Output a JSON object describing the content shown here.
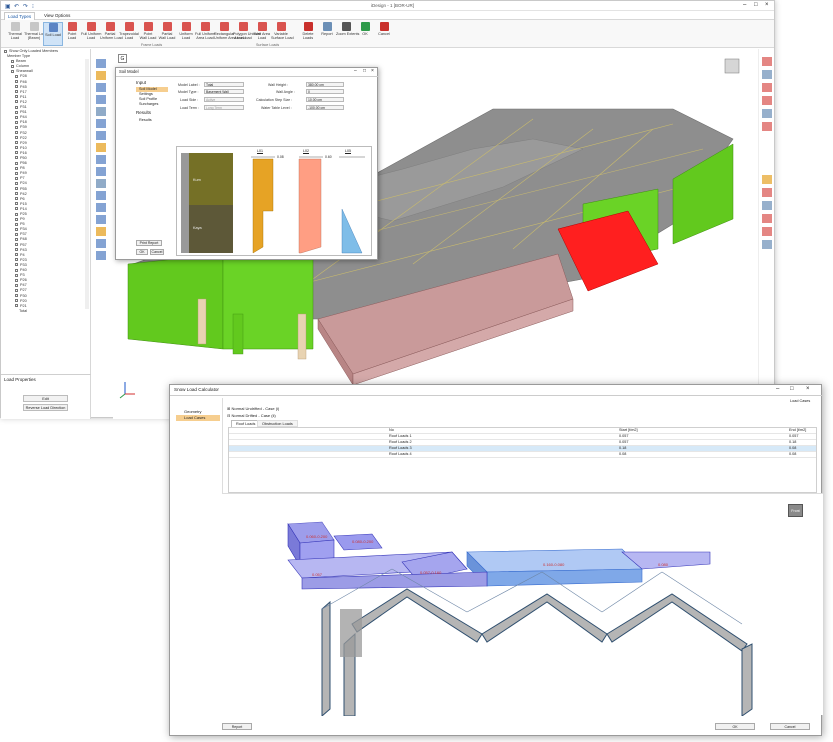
{
  "main": {
    "title": "iDesign - 1 [BOR-UR]",
    "tabs": [
      "Load Types",
      "View Options"
    ],
    "ribbon": [
      {
        "label": "Thermal\nLoad",
        "icon": "thermal-icon",
        "color": "#c7c7c7"
      },
      {
        "label": "Thermal Load\n(Beam)",
        "icon": "thermal-beam-icon",
        "color": "#c7c7c7"
      },
      {
        "label": "Soil Load",
        "icon": "soil-load-icon",
        "color": "#5b84c4",
        "active": true
      },
      {
        "label": "Point\nLoad",
        "icon": "point-load-icon",
        "color": "#d9534f"
      },
      {
        "label": "Full Uniform\nLoad",
        "icon": "full-uniform-icon",
        "color": "#d9534f"
      },
      {
        "label": "Partial\nUniform Load",
        "icon": "partial-uniform-icon",
        "color": "#d9534f"
      },
      {
        "label": "Trapezoidal\nLoad",
        "icon": "trapezoidal-icon",
        "color": "#d9534f"
      },
      {
        "label": "Point\nWall Load",
        "icon": "point-wall-icon",
        "color": "#d9534f"
      },
      {
        "label": "Partial\nWall Load",
        "icon": "partial-wall-icon",
        "color": "#d9534f"
      },
      {
        "label": "Uniform\nLoad",
        "icon": "uniform-icon",
        "color": "#d9534f"
      },
      {
        "label": "Full Uniform\nArea Load",
        "icon": "full-area-icon",
        "color": "#d9534f"
      },
      {
        "label": "Rectangular\nUniform Area Load",
        "icon": "rect-area-icon",
        "color": "#d9534f"
      },
      {
        "label": "Polygon Uniform\nArea Load",
        "icon": "polygon-area-icon",
        "color": "#d9534f"
      },
      {
        "label": "Wall Area\nLoad",
        "icon": "wall-area-icon",
        "color": "#d9534f"
      },
      {
        "label": "Variable\nSurface Load",
        "icon": "variable-surface-icon",
        "color": "#d9534f"
      },
      {
        "label": "Delete\nLoads",
        "icon": "delete-icon",
        "color": "#c9302c"
      },
      {
        "label": "Report",
        "icon": "report-icon",
        "color": "#6b8fb6"
      },
      {
        "label": "Zoom Extents",
        "icon": "zoom-extents-icon",
        "color": "#555555"
      },
      {
        "label": "OK",
        "icon": "ok-icon",
        "color": "#2e9b4a"
      },
      {
        "label": "Cancel",
        "icon": "cancel-icon",
        "color": "#c9302c"
      }
    ],
    "groups": [
      "Frame Loads",
      "Surface Loads"
    ],
    "tree": {
      "root": "Show Only Loaded Members",
      "member_type": "Member Type",
      "nodes": [
        "Beam",
        "Column",
        "Shearwall"
      ],
      "items": [
        "P28",
        "P46",
        "P45",
        "P17",
        "P11",
        "P12",
        "P31",
        "P51",
        "P44",
        "P18",
        "P39",
        "P32",
        "P22",
        "P29",
        "P10",
        "P16",
        "P50",
        "P56",
        "P8",
        "P49",
        "P7",
        "P24",
        "P55",
        "P42",
        "P6",
        "P15",
        "P14",
        "P25",
        "P9",
        "P5",
        "P34",
        "P37",
        "P48",
        "P57",
        "P43",
        "P4",
        "P23",
        "P33",
        "P40",
        "P3",
        "P26",
        "P47",
        "P27",
        "P30",
        "P20",
        "P21"
      ],
      "selected_item": "Total"
    },
    "props": {
      "title": "Load Properties",
      "edit": "Edit",
      "reverse": "Reverse Load Direction"
    },
    "viewport_label": "G"
  },
  "soil": {
    "title": "Soil Model",
    "nav": [
      "Input",
      "Soil Model",
      "Settings",
      "Soil Profile",
      "Surcharges",
      "Results",
      "Results"
    ],
    "fields": {
      "model_label": {
        "label": "Model Label :",
        "value": "Total"
      },
      "model_type": {
        "label": "Model Type :",
        "value": "Basement Wall"
      },
      "load_side": {
        "label": "Load Side :",
        "value": "Active"
      },
      "load_term": {
        "label": "Load Term :",
        "value": "Long Term"
      },
      "wall_height": {
        "label": "Wall Height :",
        "value": "380.00 cm"
      },
      "wall_angle": {
        "label": "Wall Angle :",
        "value": "0"
      },
      "calc_step": {
        "label": "Calculation Step Size :",
        "value": "10.00 cm"
      },
      "water_table": {
        "label": "Water Table Level :",
        "value": "-100.00 cm"
      }
    },
    "profile": {
      "layers": [
        "Kum",
        "Kaya"
      ],
      "headers": [
        "L01",
        "L02",
        "L05"
      ],
      "values": [
        "0.08",
        "0.60"
      ]
    },
    "buttons": {
      "print": "Print Report",
      "ok": "OK",
      "cancel": "Cancel"
    }
  },
  "snow": {
    "title": "Snow Load Calculator",
    "nav": [
      "Geometry",
      "Load Cases"
    ],
    "load_cases_label": "Load Cases",
    "cases": [
      "Normal Undrifted - Case (i)",
      "Normal Drifted - Case (ii)"
    ],
    "subtabs": [
      "Roof Loads",
      "Obstruction Loads"
    ],
    "table": {
      "headers": [
        "No",
        "Start [t/m2]",
        "End [t/m2]"
      ],
      "rows": [
        {
          "no": "Roof Loads 1",
          "start": "0.057",
          "end": "0.057"
        },
        {
          "no": "Roof Loads 2",
          "start": "0.057",
          "end": "0.18"
        },
        {
          "no": "Roof Loads 3",
          "start": "0.18",
          "end": "0.08"
        },
        {
          "no": "Roof Loads 4",
          "start": "0.08",
          "end": "0.08"
        }
      ]
    },
    "plot_labels": [
      "0.060-0.200",
      "0.057",
      "0.057-0.160",
      "0.160-0.080",
      "0.080",
      "0.080-0.200"
    ],
    "view_button": "Front",
    "buttons": {
      "report": "Report",
      "ok": "OK",
      "cancel": "Cancel"
    }
  }
}
